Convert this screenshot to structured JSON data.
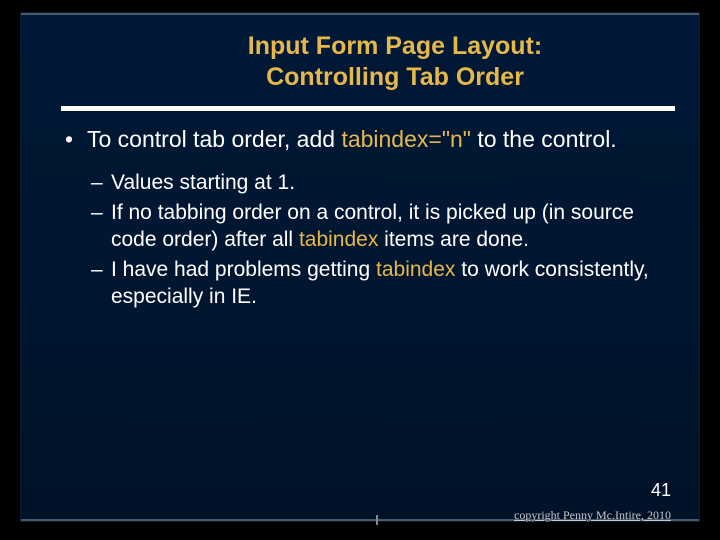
{
  "title_line1": "Input Form Page Layout:",
  "title_line2": "Controlling Tab Order",
  "bullet": {
    "pre": "To control tab order, add ",
    "kw": "tabindex=\"n\"",
    "post": " to the control."
  },
  "subs": [
    {
      "plain": "Values starting at 1."
    },
    {
      "pre": "If no tabbing order on a control, it is picked up (in source code order) after all ",
      "kw": "tabindex",
      "post": " items are done."
    },
    {
      "pre": "I have had problems getting ",
      "kw": "tabindex",
      "post": " to work consistently, especially in IE."
    }
  ],
  "page_number": "41",
  "copyright": "copyright Penny Mc.Intire, 2010"
}
